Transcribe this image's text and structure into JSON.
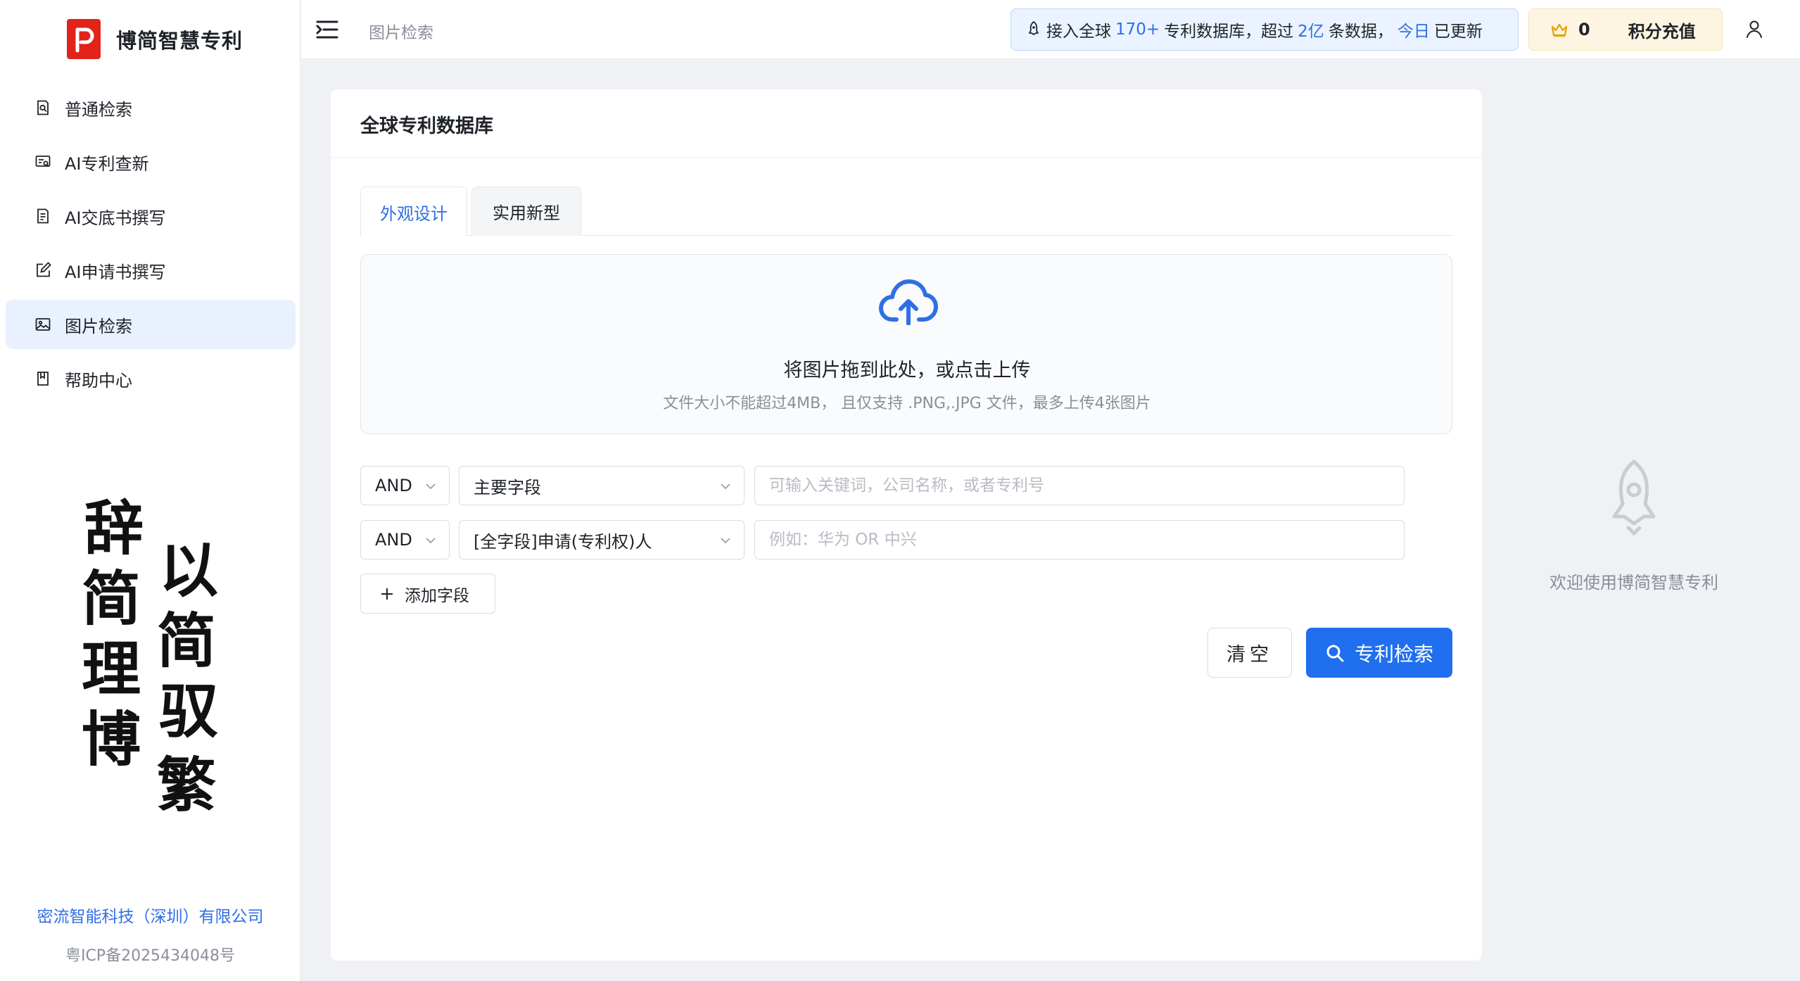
{
  "brand": {
    "name": "博简智慧专利",
    "logo_letter": "P",
    "accent": "#e2231a"
  },
  "sidebar": {
    "items": [
      {
        "label": "普通检索",
        "icon": "search-doc-icon"
      },
      {
        "label": "AI专利查新",
        "icon": "ai-check-icon"
      },
      {
        "label": "AI交底书撰写",
        "icon": "ai-doc-icon"
      },
      {
        "label": "AI申请书撰写",
        "icon": "edit-icon"
      },
      {
        "label": "图片检索",
        "icon": "image-icon",
        "active": true
      },
      {
        "label": "帮助中心",
        "icon": "book-icon"
      }
    ],
    "calligraphy_left": [
      "辞",
      "简",
      "理",
      "博"
    ],
    "calligraphy_right": [
      "以",
      "简",
      "驭",
      "繁"
    ],
    "footer": {
      "company": "密流智能科技（深圳）有限公司",
      "icp": "粤ICP备2025434048号"
    }
  },
  "header": {
    "breadcrumb": "图片检索",
    "notice": {
      "p1": "接入全球",
      "n1": "170+",
      "p2": "专利数据库，超过",
      "n2": "2亿",
      "p3": "条数据，",
      "n3": "今日",
      "p4": "已更新"
    },
    "points": {
      "count": "0",
      "recharge_label": "积分充值"
    }
  },
  "main": {
    "title": "全球专利数据库",
    "tabs": [
      {
        "label": "外观设计",
        "active": true
      },
      {
        "label": "实用新型"
      }
    ],
    "upload": {
      "main_text": "将图片拖到此处，或点击上传",
      "hint": "文件大小不能超过4MB， 且仅支持 .PNG,.JPG 文件，最多上传4张图片"
    },
    "fields": [
      {
        "logic": "AND",
        "field": "主要字段",
        "placeholder": "可输入关键词，公司名称，或者专利号"
      },
      {
        "logic": "AND",
        "field": "[全字段]申请(专利权)人",
        "placeholder": "例如：华为 OR 中兴"
      }
    ],
    "add_field_label": "添加字段",
    "clear_label": "清空",
    "search_label": "专利检索"
  },
  "right_panel": {
    "welcome": "欢迎使用博简智慧专利"
  },
  "colors": {
    "primary": "#1f6fef",
    "link": "#2f6fe6",
    "active_bg": "#e8f1fd"
  }
}
